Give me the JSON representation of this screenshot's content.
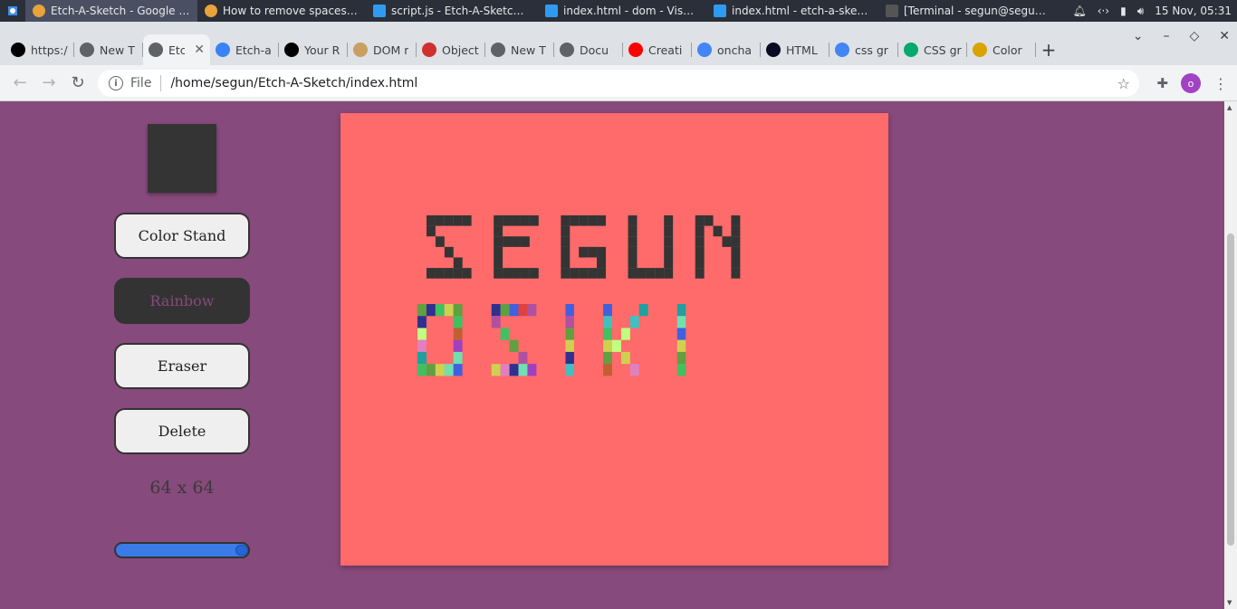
{
  "taskbar": {
    "tasks": [
      {
        "label": "Etch-A-Sketch - Google Ch...",
        "icon": "chrome-icon",
        "active": true
      },
      {
        "label": "How to remove spaces fr...",
        "icon": "chrome-icon",
        "active": false
      },
      {
        "label": "script.js - Etch-A-Sketch - ...",
        "icon": "vscode-icon",
        "active": false
      },
      {
        "label": "index.html - dom - Visual S...",
        "icon": "vscode-icon",
        "active": false
      },
      {
        "label": "index.html - etch-a-sketch ...",
        "icon": "vscode-icon",
        "active": false
      },
      {
        "label": "[Terminal - segun@segun-...",
        "icon": "terminal-icon",
        "active": false
      }
    ],
    "clock": "15 Nov, 05:31"
  },
  "tabs": [
    {
      "label": "https:/",
      "favicon": "vercel-icon",
      "color": "#000000"
    },
    {
      "label": "New T",
      "favicon": "chrome-icon",
      "color": "#5f6368"
    },
    {
      "label": "Etc",
      "favicon": "chrome-icon",
      "color": "#5f6368",
      "active": true
    },
    {
      "label": "Etch-a",
      "favicon": "brush-icon",
      "color": "#3b82f6"
    },
    {
      "label": "Your R",
      "favicon": "github-icon",
      "color": "#000000"
    },
    {
      "label": "DOM r",
      "favicon": "odin-icon",
      "color": "#c8a060"
    },
    {
      "label": "Object",
      "favicon": "figure-icon",
      "color": "#d03030"
    },
    {
      "label": "New T",
      "favicon": "chrome-icon",
      "color": "#5f6368"
    },
    {
      "label": "Docu",
      "favicon": "globe-icon",
      "color": "#5f6368"
    },
    {
      "label": "Creati",
      "favicon": "youtube-icon",
      "color": "#ff0000"
    },
    {
      "label": "oncha",
      "favicon": "google-icon",
      "color": "#4285f4"
    },
    {
      "label": "HTML",
      "favicon": "freecodecamp-icon",
      "color": "#0a0a23"
    },
    {
      "label": "css gr",
      "favicon": "google-icon",
      "color": "#4285f4"
    },
    {
      "label": "CSS gr",
      "favicon": "w3-icon",
      "color": "#04aa6d"
    },
    {
      "label": "Color",
      "favicon": "colorpicker-icon",
      "color": "#d9a300"
    }
  ],
  "omnibox": {
    "scheme": "File",
    "url": "/home/segun/Etch-A-Sketch/index.html",
    "avatar_letter": "o"
  },
  "app": {
    "buttons": {
      "color_stand": "Color Stand",
      "rainbow": "Rainbow",
      "eraser": "Eraser",
      "delete": "Delete"
    },
    "active_mode": "rainbow",
    "grid_size_label": "64 x 64",
    "slider_value": 64,
    "slider_max": 64,
    "current_color": "#343434",
    "canvas_color": "#ff6a6a",
    "page_bg": "#874a7c",
    "drawing": {
      "line1_text": "SEGUN",
      "line1_color": "#343434",
      "line2_text": "OSIKI",
      "line2_style": "rainbow"
    }
  }
}
